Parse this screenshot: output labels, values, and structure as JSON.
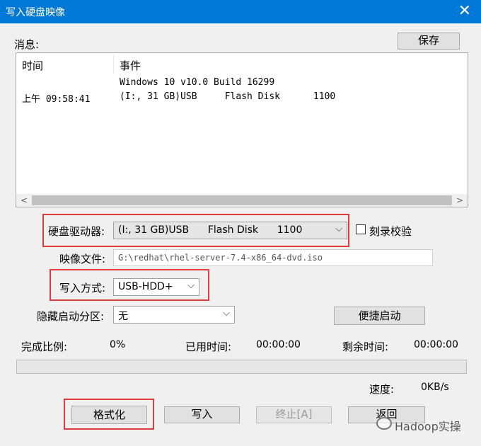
{
  "window": {
    "title": "写入硬盘映像",
    "close_glyph": "✕"
  },
  "messages": {
    "label": "消息:",
    "save_button": "保存",
    "columns": [
      "时间",
      "事件"
    ],
    "rows": [
      {
        "time": "",
        "event": "Windows 10 v10.0 Build 16299"
      },
      {
        "time": "上午 09:58:41",
        "event": "(I:, 31 GB)USB     Flash Disk      1100"
      }
    ],
    "scroll_left": "<",
    "scroll_right": ">"
  },
  "disk": {
    "label": "硬盘驱动器:",
    "value": "(I:, 31 GB)USB      Flash Disk      1100",
    "verify_label": "刻录校验"
  },
  "image_file": {
    "label": "映像文件:",
    "value": "G:\\redhat\\rhel-server-7.4-x86_64-dvd.iso"
  },
  "write_mode": {
    "label": "写入方式:",
    "value": "USB-HDD+"
  },
  "hidden_partition": {
    "label": "隐藏启动分区:",
    "value": "无",
    "quick_boot_button": "便捷启动"
  },
  "status": {
    "complete_label": "完成比例:",
    "complete_value": "0%",
    "elapsed_label": "已用时间:",
    "elapsed_value": "00:00:00",
    "remaining_label": "剩余时间:",
    "remaining_value": "00:00:00",
    "speed_label": "速度:",
    "speed_value": "0KB/s",
    "progress_fraction": 0
  },
  "actions": {
    "format": "格式化",
    "write": "写入",
    "stop": "终止[A]",
    "back": "返回"
  },
  "watermark": {
    "text": "Hadoop实操"
  },
  "colors": {
    "titlebar": "#0078d7",
    "highlight_box": "#e13b3b"
  }
}
